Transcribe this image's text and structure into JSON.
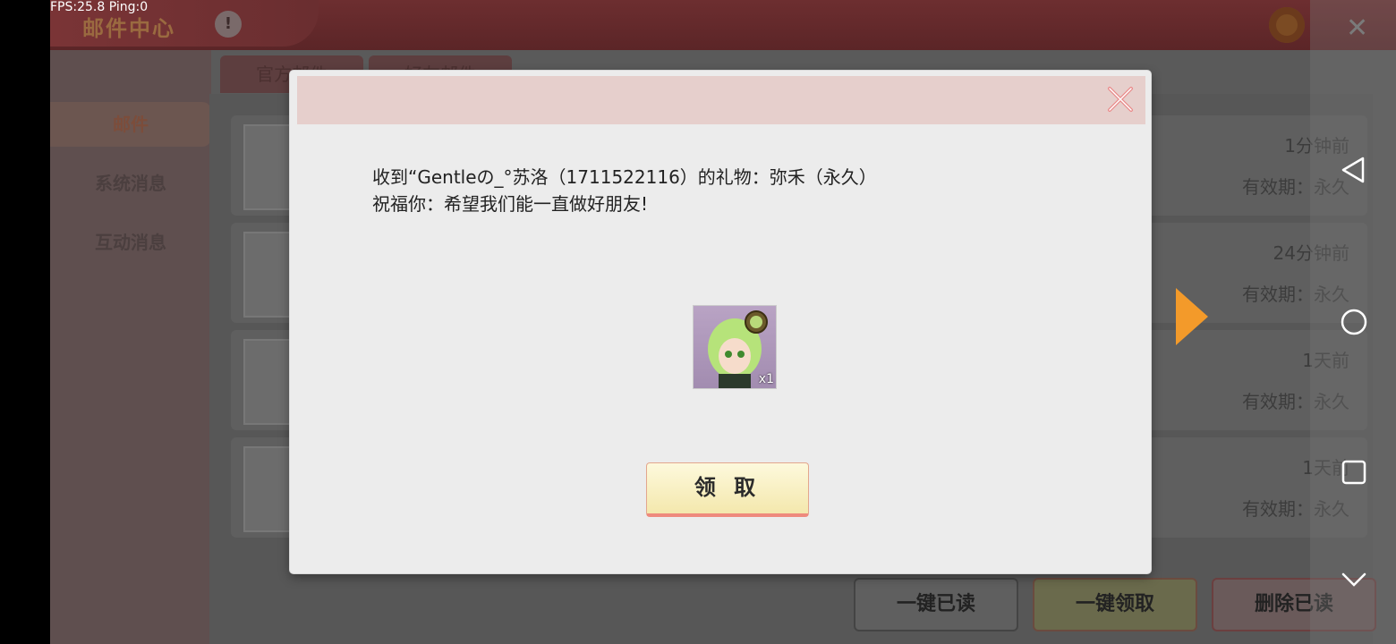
{
  "overlay": {
    "fps": "FPS:25.8",
    "ping": "Ping:0"
  },
  "header": {
    "title": "邮件中心",
    "info_label": "!"
  },
  "sidebar": {
    "items": [
      {
        "label": "邮件"
      },
      {
        "label": "系统消息"
      },
      {
        "label": "互动消息"
      }
    ]
  },
  "tabs": [
    {
      "label": "官方邮件"
    },
    {
      "label": "好友邮件"
    }
  ],
  "mail_list": [
    {
      "time": "1分钟前",
      "expiry": "有效期：永久"
    },
    {
      "time": "24分钟前",
      "expiry": "有效期：永久"
    },
    {
      "time": "1天前",
      "expiry": "有效期：永久"
    },
    {
      "time": "1天前",
      "expiry": "有效期：永久"
    }
  ],
  "footer_buttons": [
    {
      "label": "一键已读"
    },
    {
      "label": "一键领取"
    },
    {
      "label": "删除已读"
    }
  ],
  "dialog": {
    "line1": "收到“Gentleの_°苏洛（1711522116）的礼物：弥禾（永久）",
    "line2": "祝福你：希望我们能一直做好朋友!",
    "gift_quantity": "x1",
    "claim_label": "领 取"
  },
  "colors": {
    "accent": "#f39a2a",
    "claim_border": "#ee8a7d",
    "header_bar": "#e6cfcc"
  }
}
